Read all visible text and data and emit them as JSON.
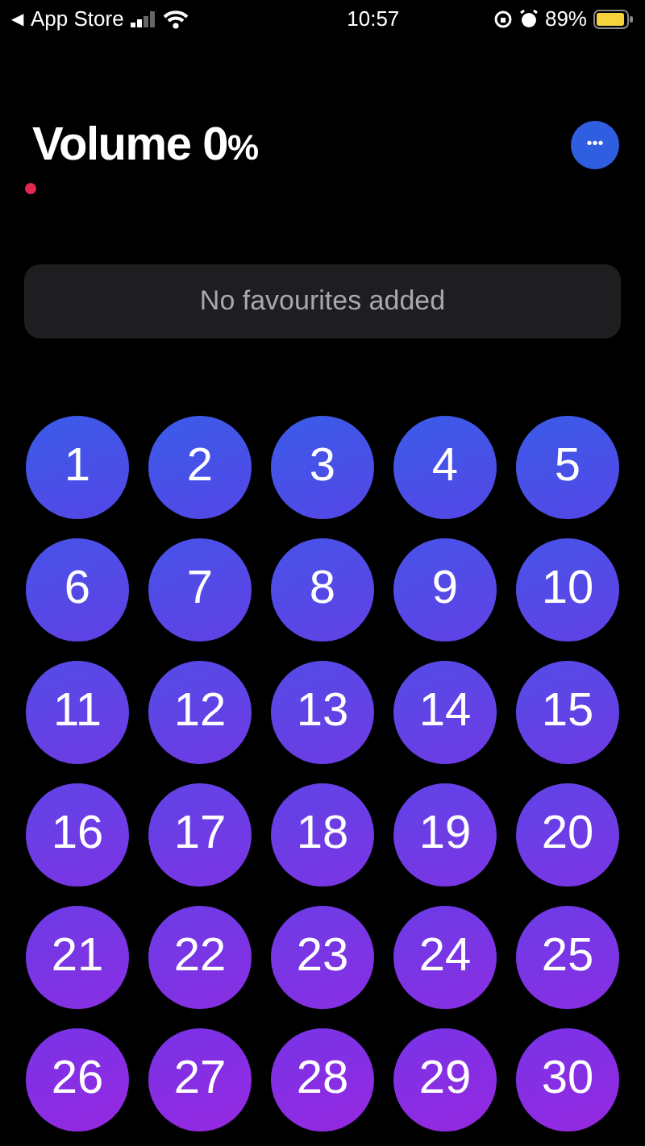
{
  "status_bar": {
    "back_arrow": "◀",
    "back_label": "App Store",
    "time": "10:57",
    "battery": "89%"
  },
  "header": {
    "title": "Volume 0",
    "unit": "%",
    "more": "•••"
  },
  "favourites": {
    "empty_text": "No favourites added"
  },
  "buttons": [
    "1",
    "2",
    "3",
    "4",
    "5",
    "6",
    "7",
    "8",
    "9",
    "10",
    "11",
    "12",
    "13",
    "14",
    "15",
    "16",
    "17",
    "18",
    "19",
    "20",
    "21",
    "22",
    "23",
    "24",
    "25",
    "26",
    "27",
    "28",
    "29",
    "30"
  ]
}
